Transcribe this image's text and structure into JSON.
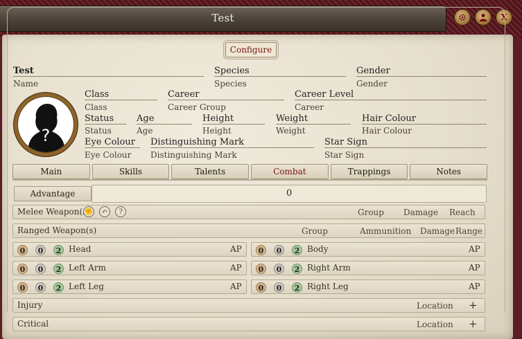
{
  "window": {
    "title": "Test"
  },
  "toolbar": {
    "configure": "Configure",
    "close": "X"
  },
  "identity": {
    "name_value": "Test",
    "name_label": "Name",
    "species_value": "Species",
    "species_label": "Species",
    "gender_value": "Gender",
    "gender_label": "Gender"
  },
  "details": {
    "class_value": "Class",
    "class_label": "Class",
    "career_value": "Career",
    "career_label": "Career Group",
    "career_level_value": "Career Level",
    "career_level_label": "Career",
    "status_value": "Status",
    "status_label": "Status",
    "age_value": "Age",
    "age_label": "Age",
    "height_value": "Height",
    "height_label": "Height",
    "weight_value": "Weight",
    "weight_label": "Weight",
    "hair_value": "Hair Colour",
    "hair_label": "Hair Colour",
    "eye_value": "Eye Colour",
    "eye_label": "Eye Colour",
    "mark_value": "Distinguishing Mark",
    "mark_label": "Distinguishing Mark",
    "starsign_value": "Star Sign",
    "starsign_label": "Star Sign"
  },
  "portrait": {
    "placeholder": "?"
  },
  "tabs": [
    "Main",
    "Skills",
    "Talents",
    "Combat",
    "Trappings",
    "Notes"
  ],
  "combat": {
    "advantage_label": "Advantage",
    "advantage_value": "0",
    "melee": {
      "label": "Melee Weapon(s)",
      "cols": [
        "Group",
        "Damage",
        "Reach"
      ]
    },
    "ranged": {
      "label": "Ranged Weapon(s)",
      "cols": [
        "Group",
        "Ammunition",
        "Damage",
        "Range"
      ]
    },
    "armour": [
      {
        "a": "0",
        "b": "0",
        "c": "2",
        "loc": "Head",
        "ap": "AP"
      },
      {
        "a": "0",
        "b": "0",
        "c": "2",
        "loc": "Body",
        "ap": "AP"
      },
      {
        "a": "0",
        "b": "0",
        "c": "2",
        "loc": "Left Arm",
        "ap": "AP"
      },
      {
        "a": "0",
        "b": "0",
        "c": "2",
        "loc": "Right Arm",
        "ap": "AP"
      },
      {
        "a": "0",
        "b": "0",
        "c": "2",
        "loc": "Left Leg",
        "ap": "AP"
      },
      {
        "a": "0",
        "b": "0",
        "c": "2",
        "loc": "Right Leg",
        "ap": "AP"
      }
    ],
    "injury": {
      "label": "Injury",
      "col": "Location",
      "add": "+"
    },
    "critical": {
      "label": "Critical",
      "col": "Location",
      "add": "+"
    }
  },
  "colors": {
    "accent": "#7a1414",
    "frame": "#5a1f24",
    "parchment": "#e8e1cf"
  }
}
